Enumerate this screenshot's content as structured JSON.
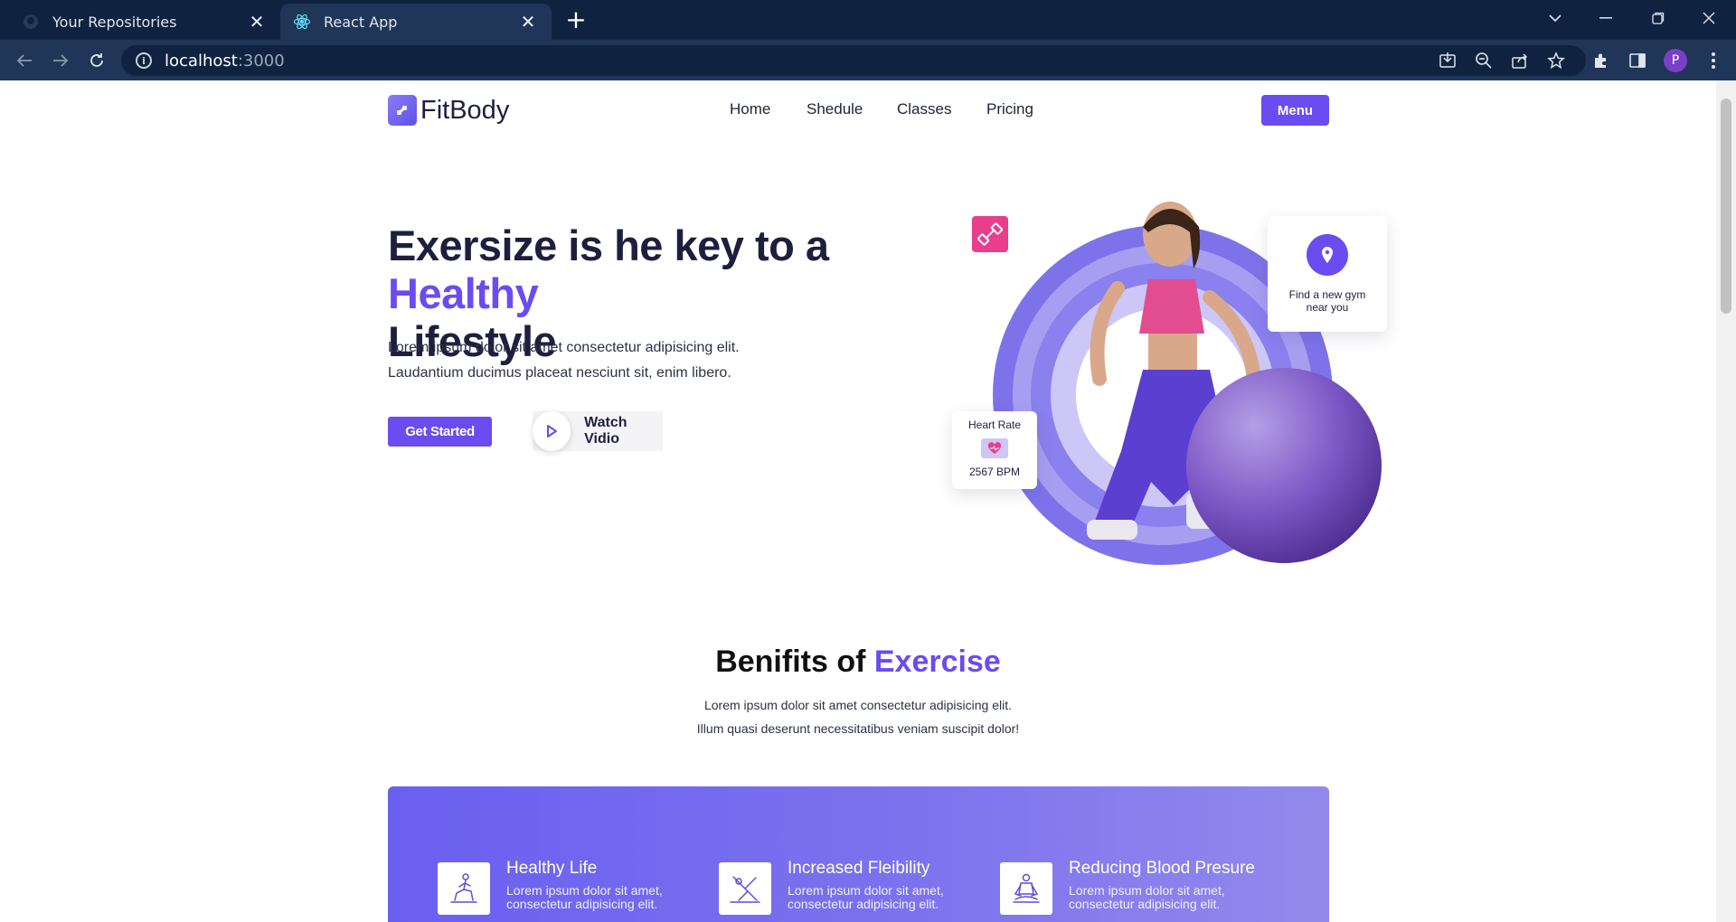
{
  "browser": {
    "tabs": [
      {
        "title": "Your Repositories",
        "icon": "github-icon",
        "active": false
      },
      {
        "title": "React App",
        "icon": "react-icon",
        "active": true
      }
    ],
    "close_glyph": "✕",
    "newtab_glyph": "+",
    "address": {
      "host": "localhost",
      "port": ":3000"
    },
    "avatar_letter": "P"
  },
  "nav": {
    "brand": "FitBody",
    "links": [
      "Home",
      "Shedule",
      "Classes",
      "Pricing"
    ],
    "menu_label": "Menu"
  },
  "hero": {
    "title_part1": "Exersize is he key to a ",
    "title_accent": "Healthy",
    "title_part2": "Lifestyle",
    "paragraph_line1": "Lorem ipsum dolor sit amet consectetur adipisicing elit.",
    "paragraph_line2": "Laudantium ducimus placeat nesciunt sit, enim libero.",
    "cta_label": "Get Started",
    "watch_label": "Watch Vidio",
    "gym_card_line1": "Find a new gym",
    "gym_card_line2": "near you",
    "heart_title": "Heart Rate",
    "heart_value": "2567 BPM"
  },
  "benefits": {
    "title_part1": "Benifits of ",
    "title_accent": "Exercise",
    "text_line1": "Lorem ipsum dolor sit amet consectetur adipisicing elit.",
    "text_line2": "Illum quasi deserunt necessitatibus veniam suscipit dolor!",
    "items": [
      {
        "title": "Healthy Life",
        "desc": "Lorem ipsum dolor sit amet, consectetur adipisicing elit.",
        "icon": "lunge-pose-icon"
      },
      {
        "title": "Increased Fleibility",
        "desc": "Lorem ipsum dolor sit amet, consectetur adipisicing elit.",
        "icon": "stretch-pose-icon"
      },
      {
        "title": "Reducing Blood Presure",
        "desc": "Lorem ipsum dolor sit amet, consectetur adipisicing elit.",
        "icon": "meditation-pose-icon"
      }
    ]
  },
  "colors": {
    "accent": "#6a4cf0",
    "chrome_dark": "#0f2340",
    "chrome_mid": "#1f3658",
    "badge_pink": "#e83e8c"
  }
}
